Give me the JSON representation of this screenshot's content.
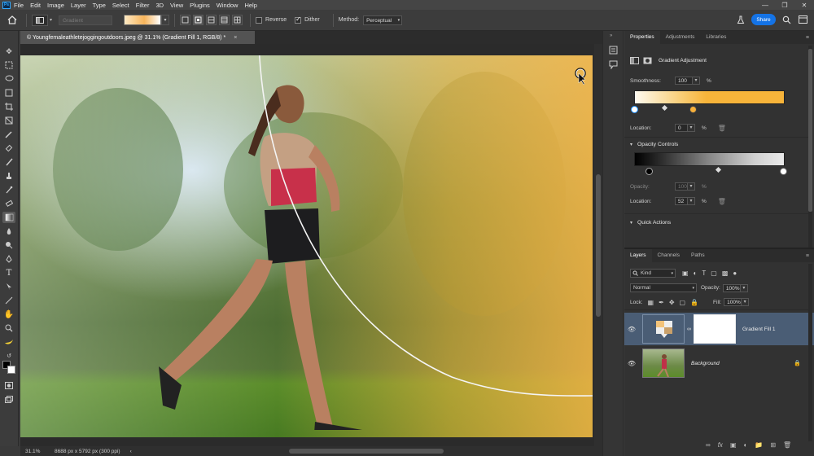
{
  "app": {
    "logo_text": "Ps",
    "menu": [
      "File",
      "Edit",
      "Image",
      "Layer",
      "Type",
      "Select",
      "Filter",
      "3D",
      "View",
      "Plugins",
      "Window",
      "Help"
    ],
    "window_controls": [
      "—",
      "❐",
      "✕"
    ]
  },
  "options_bar": {
    "preset_placeholder": "Gradient",
    "reverse_label": "Reverse",
    "reverse_checked": false,
    "dither_label": "Dither",
    "dither_checked": true,
    "method_label": "Method:",
    "method_value": "Perceptual",
    "share_label": "Share"
  },
  "document": {
    "tab_title": "© Youngfemaleathletejoggingoutdoors.jpeg @ 31.1% (Gradient Fill 1, RGB/8) *",
    "tab_close": "×",
    "zoom": "31.1%",
    "doc_info": "8688 px x 5792 px (300 ppi)",
    "status_arrow": "‹"
  },
  "properties_panel": {
    "tabs": [
      "Properties",
      "Adjustments",
      "Libraries"
    ],
    "subtitle": "Gradient Adjustment",
    "smoothness_label": "Smoothness:",
    "smoothness_value": "100",
    "percent": "%",
    "color_location_label": "Location:",
    "color_location_value": "0",
    "opacity_controls_title": "Opacity Controls",
    "opacity_label": "Opacity:",
    "opacity_value": "100",
    "opacity_location_label": "Location:",
    "opacity_location_value": "52",
    "quick_actions_title": "Quick Actions"
  },
  "layers_panel": {
    "tabs": [
      "Layers",
      "Channels",
      "Paths"
    ],
    "filter_kind": "Kind",
    "blend_mode": "Normal",
    "opacity_label": "Opacity:",
    "opacity_value": "100%",
    "lock_label": "Lock:",
    "fill_label": "Fill:",
    "fill_value": "100%",
    "layers": [
      {
        "name": "Gradient Fill 1",
        "selected": true
      },
      {
        "name": "Background",
        "selected": false
      }
    ],
    "bottom_icons": [
      "link-icon",
      "fx-icon",
      "mask-icon",
      "adjustment-icon",
      "group-icon",
      "new-layer-icon",
      "trash-icon"
    ]
  },
  "colors": {
    "accent": "#1473e6",
    "gradient_orange": "#f7b03a",
    "selected_layer": "#4a5d75"
  }
}
